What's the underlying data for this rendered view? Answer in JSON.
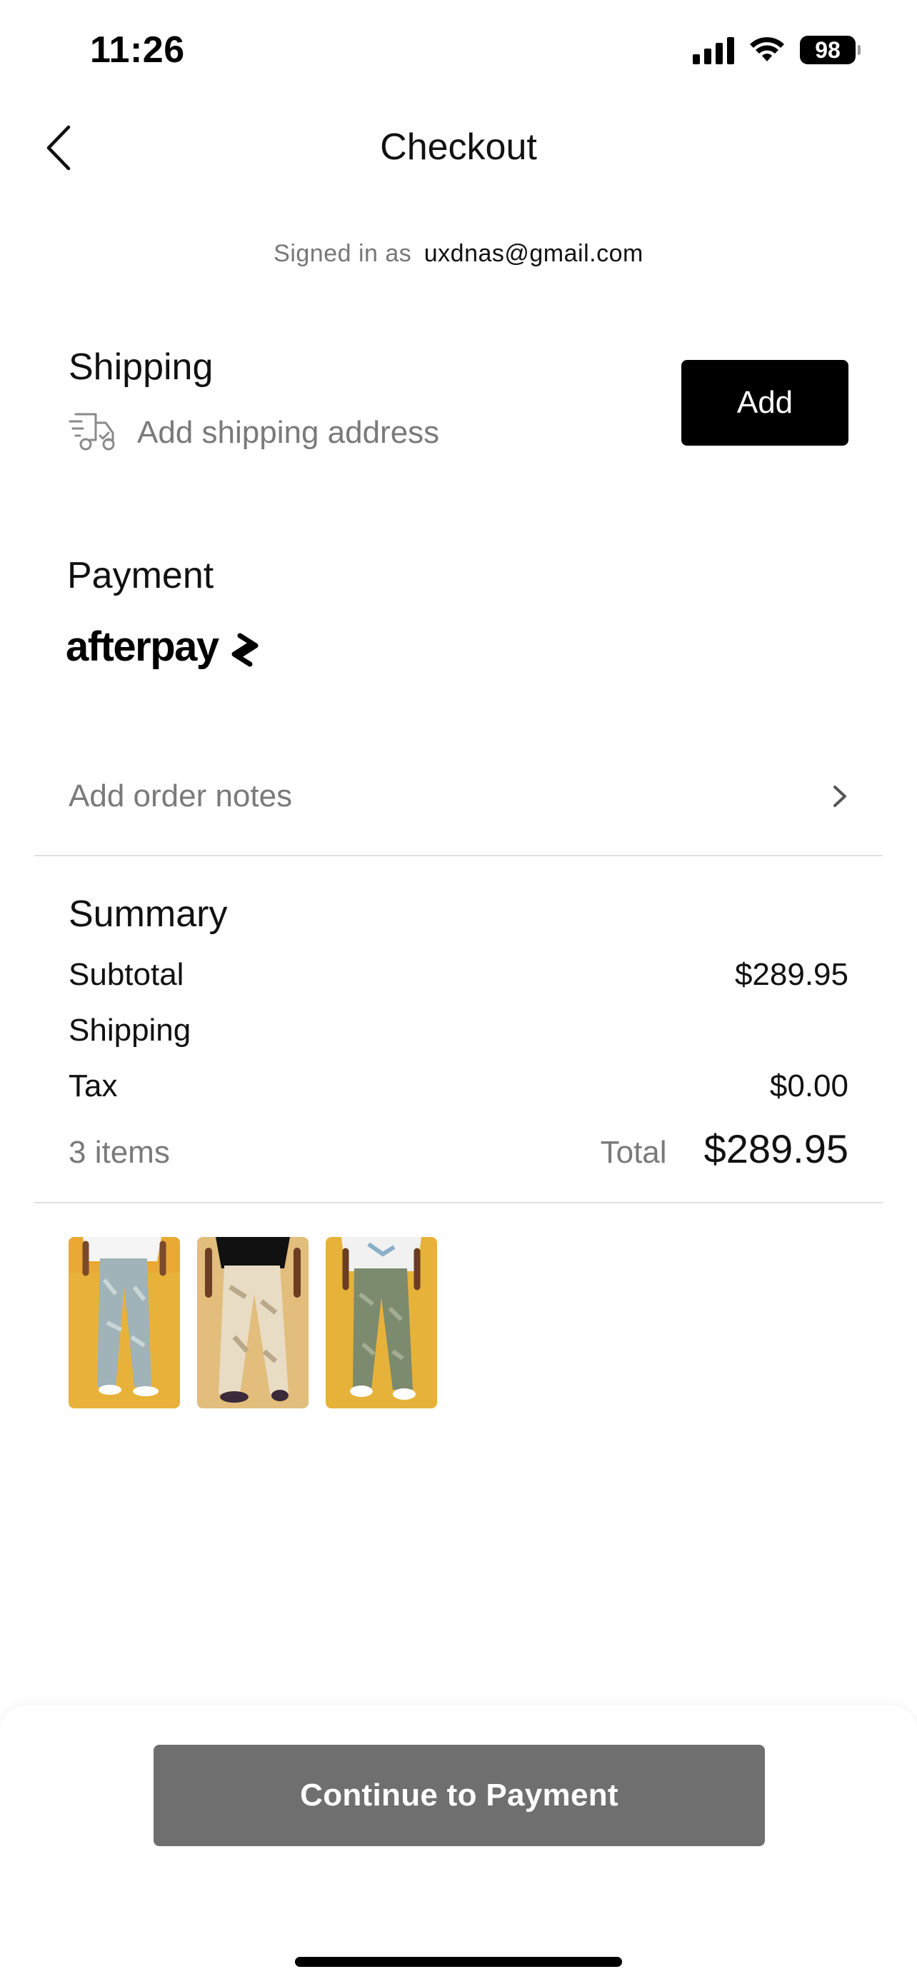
{
  "status_bar": {
    "time": "11:26",
    "battery": "98"
  },
  "nav": {
    "title": "Checkout"
  },
  "account": {
    "signed_in_label": "Signed in as",
    "email": "uxdnas@gmail.com"
  },
  "shipping": {
    "title": "Shipping",
    "placeholder": "Add shipping address",
    "add_button": "Add"
  },
  "payment": {
    "title": "Payment",
    "method_logo_text": "afterpay"
  },
  "order_notes": {
    "label": "Add order notes"
  },
  "summary": {
    "title": "Summary",
    "rows": [
      {
        "label": "Subtotal",
        "value": "$289.95"
      },
      {
        "label": "Shipping",
        "value": ""
      },
      {
        "label": "Tax",
        "value": "$0.00"
      }
    ],
    "items_count": "3 items",
    "total_label": "Total",
    "total_value": "$289.95"
  },
  "products": [
    {
      "thumb": "product-thumb-1"
    },
    {
      "thumb": "product-thumb-2"
    },
    {
      "thumb": "product-thumb-3"
    }
  ],
  "footer": {
    "continue_button": "Continue to Payment"
  },
  "colors": {
    "accent": "#000000",
    "muted_text": "#7a7a7a",
    "disabled_button": "#6f6f6f",
    "product_bg": "#e8b23a"
  }
}
